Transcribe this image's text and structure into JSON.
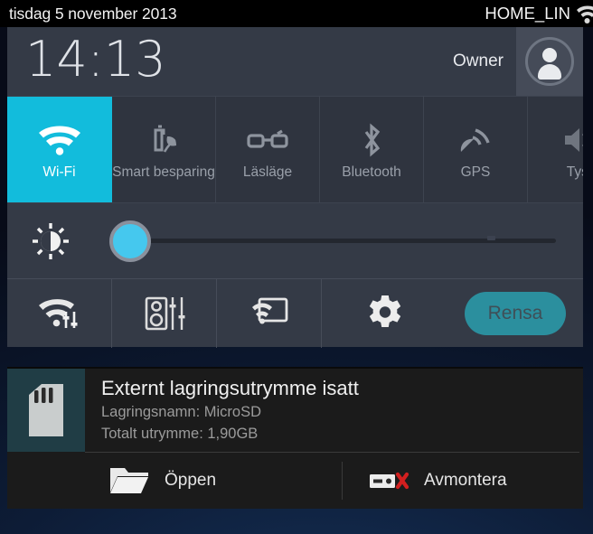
{
  "statusbar": {
    "date": "tisdag 5 november 2013",
    "ssid": "HOME_LIN",
    "wifi_icon": "wifi-signal-icon"
  },
  "header": {
    "clock": "14:13",
    "owner_label": "Owner",
    "avatar_icon": "user-avatar-icon"
  },
  "tiles": [
    {
      "label": "Wi-Fi",
      "icon": "wifi-icon",
      "active": true
    },
    {
      "label": "Smart besparing",
      "icon": "battery-leaf-icon",
      "active": false
    },
    {
      "label": "Läsläge",
      "icon": "reading-glasses-icon",
      "active": false
    },
    {
      "label": "Bluetooth",
      "icon": "bluetooth-icon",
      "active": false
    },
    {
      "label": "GPS",
      "icon": "gps-satellite-icon",
      "active": false
    },
    {
      "label": "Tyst",
      "icon": "mute-speaker-icon",
      "active": false
    }
  ],
  "brightness": {
    "icon": "brightness-sun-icon",
    "value_percent": 4
  },
  "actions": {
    "items": [
      {
        "icon": "wifi-settings-icon"
      },
      {
        "icon": "sound-settings-icon"
      },
      {
        "icon": "screen-mirroring-icon"
      },
      {
        "icon": "gear-icon"
      }
    ],
    "clear_label": "Rensa",
    "clear_color": "#2b8f9e"
  },
  "notification": {
    "icon": "sd-card-icon",
    "title": "Externt lagringsutrymme isatt",
    "line1": "Lagringsnamn: MicroSD",
    "line2": "Totalt utrymme: 1,90GB",
    "action_open": {
      "label": "Öppen",
      "icon": "folder-open-icon"
    },
    "action_unmount": {
      "label": "Avmontera",
      "icon": "eject-usb-icon"
    }
  }
}
